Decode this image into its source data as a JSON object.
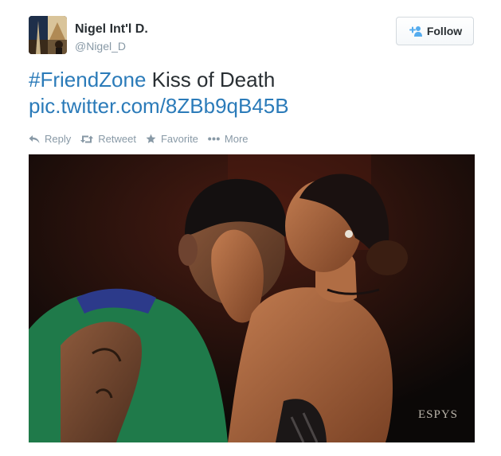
{
  "user": {
    "display_name": "Nigel Int'l D.",
    "screen_name": "@Nigel_D"
  },
  "follow_button": {
    "label": "Follow",
    "icon": "add-user-icon"
  },
  "tweet": {
    "hashtag": "#FriendZone",
    "text": " Kiss of Death",
    "link": "pic.twitter.com/8ZBb9qB45B"
  },
  "actions": [
    {
      "label": "Reply",
      "icon": "reply-icon"
    },
    {
      "label": "Retweet",
      "icon": "retweet-icon"
    },
    {
      "label": "Favorite",
      "icon": "star-icon"
    },
    {
      "label": "More",
      "icon": "more-icon"
    }
  ],
  "media": {
    "watermark": "ESPYS"
  },
  "colors": {
    "link": "#2b7bb9",
    "muted": "#8899a6",
    "text": "#292f33",
    "follow_icon": "#55acee"
  }
}
